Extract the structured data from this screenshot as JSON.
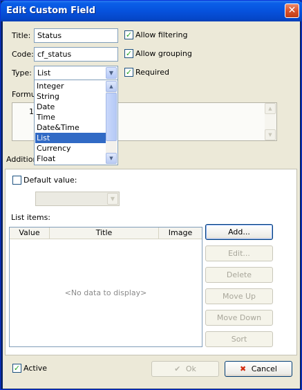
{
  "window": {
    "title": "Edit Custom Field",
    "close_glyph": "✕"
  },
  "form": {
    "title_label": "Title:",
    "title_value": "Status",
    "code_label": "Code:",
    "code_value": "cf_status",
    "type_label": "Type:",
    "type_value": "List",
    "formula_label_partial": "Formul",
    "formula_line_number": "1",
    "additional_label_partial": "Addition"
  },
  "options": {
    "allow_filtering": {
      "label": "Allow filtering",
      "checked": true
    },
    "allow_grouping": {
      "label": "Allow grouping",
      "checked": true
    },
    "required": {
      "label": "Required",
      "checked": true
    }
  },
  "type_dropdown": {
    "items": [
      "Integer",
      "String",
      "Date",
      "Time",
      "Date&Time",
      "List",
      "Currency",
      "Float"
    ],
    "selected": "List",
    "scroll_up_glyph": "▲",
    "scroll_down_glyph": "▼"
  },
  "additional": {
    "default_value_label": "Default value:",
    "default_value_checked": false,
    "default_value_selection": "",
    "list_items_label": "List items:",
    "columns": [
      "Value",
      "Title",
      "Image"
    ],
    "empty_text": "<No data to display>"
  },
  "list_buttons": {
    "add": "Add...",
    "edit": "Edit...",
    "delete": "Delete",
    "move_up": "Move Up",
    "move_down": "Move Down",
    "sort": "Sort"
  },
  "footer": {
    "active_label": "Active",
    "active_checked": true,
    "ok_label": "Ok",
    "cancel_label": "Cancel",
    "ok_icon": "✔",
    "cancel_icon": "✖"
  },
  "icons": {
    "check": "✓",
    "combo_arrow": "▼"
  },
  "colors": {
    "title_bar": "#0652dd",
    "selection": "#316ac5",
    "checkmark": "#21a121",
    "cancel_icon": "#d22c10",
    "ok_icon_disabled": "#b8b6aa"
  }
}
